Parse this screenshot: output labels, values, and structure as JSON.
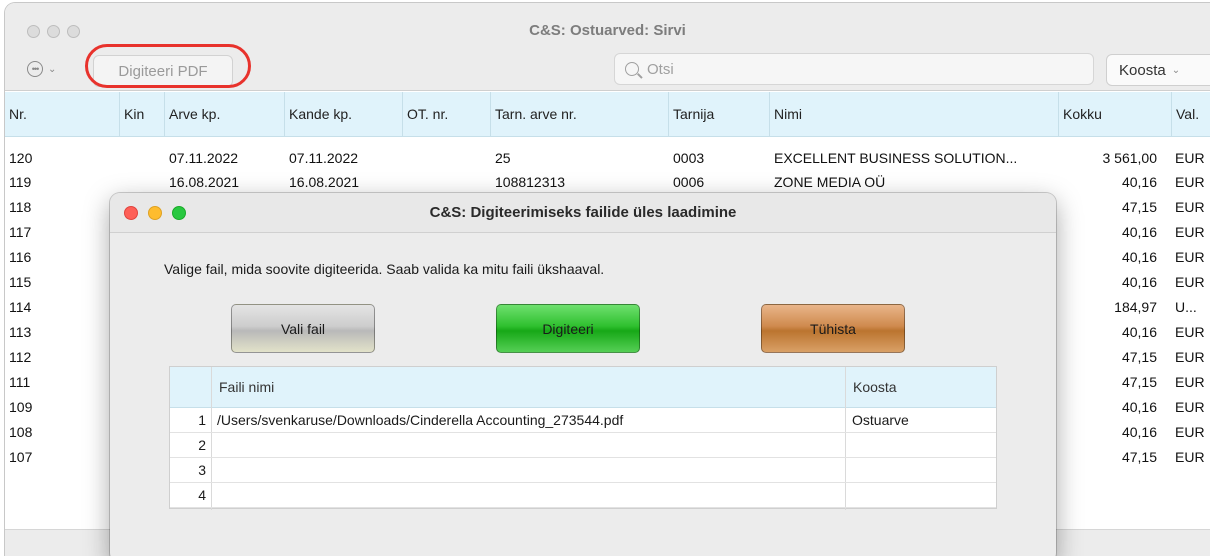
{
  "window": {
    "title": "C&S: Ostuarved: Sirvi",
    "toolbar": {
      "digiteeri_pdf_label": "Digiteeri PDF",
      "search_placeholder": "Otsi",
      "koosta_label": "Koosta"
    },
    "highlight_color": "#e8322c"
  },
  "table": {
    "columns": [
      "Nr.",
      "Kin",
      "Arve kp.",
      "Kande kp.",
      "OT. nr.",
      "Tarn. arve nr.",
      "Tarnija",
      "Nimi",
      "Kokku",
      "Val."
    ],
    "rows": [
      {
        "nr": "120",
        "kin": "",
        "arve": "07.11.2022",
        "kande": "07.11.2022",
        "ot": "",
        "tarn_arve": "25",
        "tarnija": "0003",
        "nimi": "EXCELLENT BUSINESS SOLUTION...",
        "kokku": "3 561,00",
        "val": "EUR"
      },
      {
        "nr": "119",
        "kin": "",
        "arve": "16.08.2021",
        "kande": "16.08.2021",
        "ot": "",
        "tarn_arve": "108812313",
        "tarnija": "0006",
        "nimi": "ZONE MEDIA OÜ",
        "kokku": "40,16",
        "val": "EUR"
      },
      {
        "nr": "118",
        "kokku": "47,15",
        "val": "EUR"
      },
      {
        "nr": "117",
        "kokku": "40,16",
        "val": "EUR"
      },
      {
        "nr": "116",
        "kokku": "40,16",
        "val": "EUR"
      },
      {
        "nr": "115",
        "kokku": "40,16",
        "val": "EUR"
      },
      {
        "nr": "114",
        "kokku": "184,97",
        "val": "U..."
      },
      {
        "nr": "113",
        "kokku": "40,16",
        "val": "EUR"
      },
      {
        "nr": "112",
        "kokku": "47,15",
        "val": "EUR"
      },
      {
        "nr": "111",
        "kokku": "47,15",
        "val": "EUR"
      },
      {
        "nr": "109",
        "kokku": "40,16",
        "val": "EUR"
      },
      {
        "nr": "108",
        "kokku": "40,16",
        "val": "EUR"
      },
      {
        "nr": "107",
        "kokku": "47,15",
        "val": "EUR"
      }
    ]
  },
  "dialog": {
    "title": "C&S: Digiteerimiseks failide üles laadimine",
    "instruction": "Valige fail, mida soovite digiteerida. Saab valida ka mitu faili ükshaaval.",
    "buttons": {
      "vali_fail": "Vali fail",
      "digiteeri": "Digiteeri",
      "tuhista": "Tühista"
    },
    "button_colors": {
      "vali_fail": "#cdcdcd",
      "digiteeri": "#2fc02f",
      "tuhista": "#cf8a4e"
    },
    "file_table": {
      "columns": [
        "",
        "Faili nimi",
        "Koosta"
      ],
      "rows": [
        {
          "num": "1",
          "path": "/Users/svenkaruse/Downloads/Cinderella Accounting_273544.pdf",
          "koosta": "Ostuarve"
        },
        {
          "num": "2",
          "path": "",
          "koosta": ""
        },
        {
          "num": "3",
          "path": "",
          "koosta": ""
        },
        {
          "num": "4",
          "path": "",
          "koosta": ""
        }
      ]
    }
  }
}
